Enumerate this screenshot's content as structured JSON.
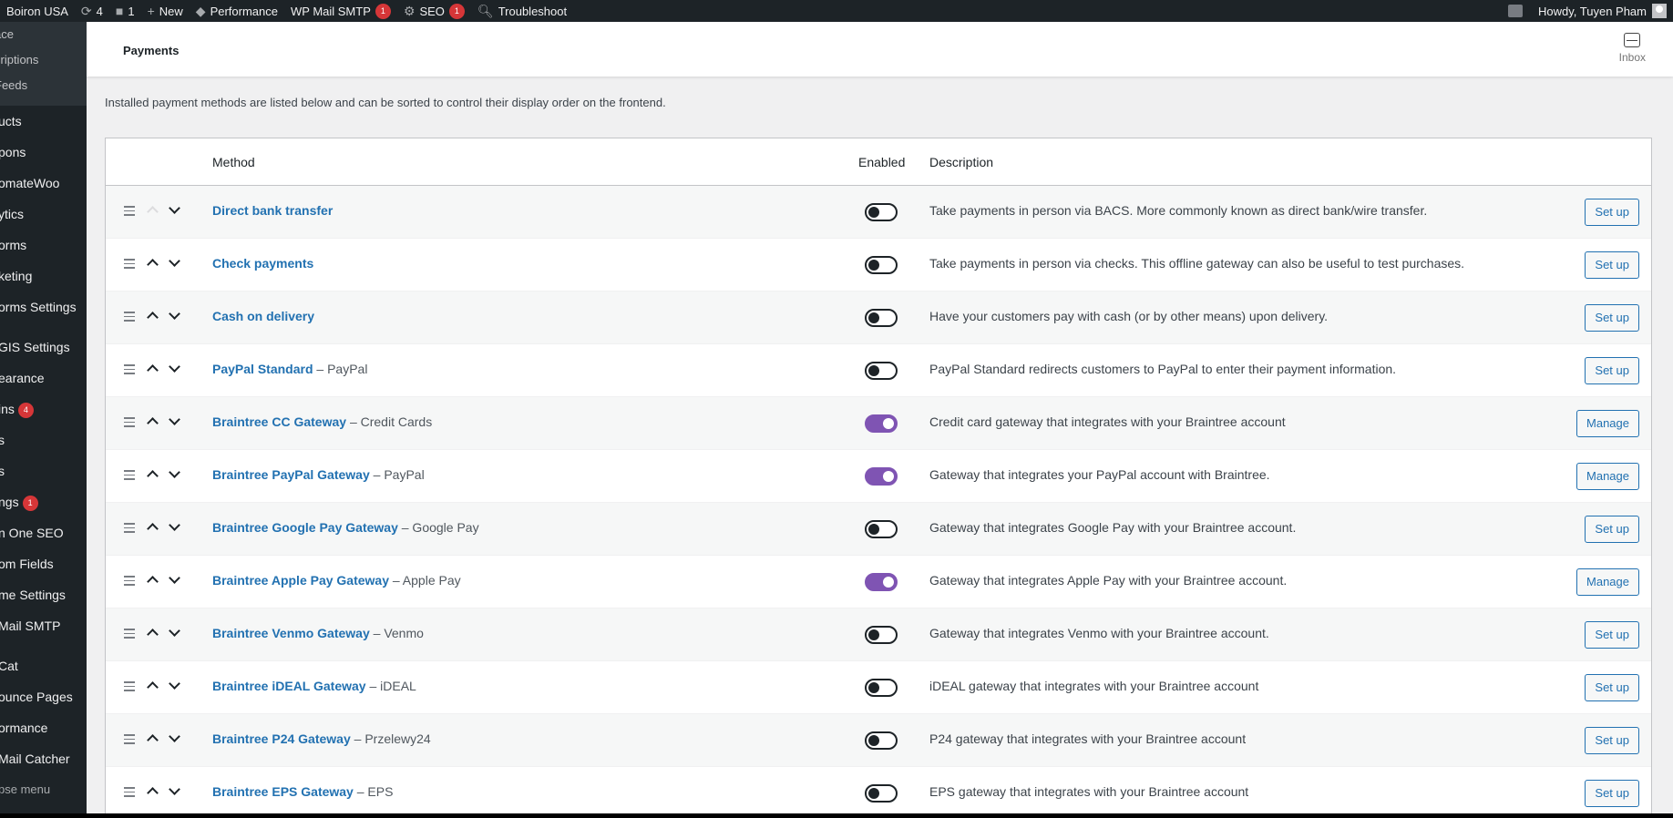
{
  "adminbar": {
    "site_name": "Boiron USA",
    "updates_count": "4",
    "comments_count": "1",
    "new_label": "New",
    "performance_label": "Performance",
    "mail_smtp_label": "WP Mail SMTP",
    "mail_smtp_badge": "1",
    "seo_label": "SEO",
    "seo_badge": "1",
    "troubleshoot_label": "Troubleshoot",
    "howdy": "Howdy, Tuyen Pham"
  },
  "sidebar": {
    "submenu": [
      "ace",
      "criptions",
      "Feeds"
    ],
    "menu": [
      {
        "label": "ucts"
      },
      {
        "label": "pons"
      },
      {
        "label": "omateWoo"
      },
      {
        "label": "ytics"
      },
      {
        "label": "orms"
      },
      {
        "label": "keting"
      },
      {
        "label": "orms Settings"
      },
      {
        "label": "GIS Settings"
      },
      {
        "label": "earance"
      },
      {
        "label": "ins",
        "badge": "4"
      },
      {
        "label": "s"
      },
      {
        "label": "s"
      },
      {
        "label": "ngs",
        "badge": "1"
      },
      {
        "label": "n One SEO"
      },
      {
        "label": "om Fields"
      },
      {
        "label": "me Settings"
      },
      {
        "label": "Mail SMTP"
      },
      {
        "label": "Cat"
      },
      {
        "label": "ounce Pages"
      },
      {
        "label": "ormance"
      },
      {
        "label": "Mail Catcher"
      },
      {
        "label": "pse menu"
      }
    ]
  },
  "header": {
    "title": "Payments",
    "inbox_label": "Inbox"
  },
  "intro": "Installed payment methods are listed below and can be sorted to control their display order on the frontend.",
  "table": {
    "col_method": "Method",
    "col_enabled": "Enabled",
    "col_description": "Description",
    "rows": [
      {
        "name": "Direct bank transfer",
        "sub": "",
        "enabled": false,
        "description": "Take payments in person via BACS. More commonly known as direct bank/wire transfer.",
        "action": "Set up",
        "up_disabled": true
      },
      {
        "name": "Check payments",
        "sub": "",
        "enabled": false,
        "description": "Take payments in person via checks. This offline gateway can also be useful to test purchases.",
        "action": "Set up"
      },
      {
        "name": "Cash on delivery",
        "sub": "",
        "enabled": false,
        "description": "Have your customers pay with cash (or by other means) upon delivery.",
        "action": "Set up"
      },
      {
        "name": "PayPal Standard",
        "sub": " – PayPal",
        "enabled": false,
        "description": "PayPal Standard redirects customers to PayPal to enter their payment information.",
        "action": "Set up"
      },
      {
        "name": "Braintree CC Gateway",
        "sub": " – Credit Cards",
        "enabled": true,
        "description": "Credit card gateway that integrates with your Braintree account",
        "action": "Manage"
      },
      {
        "name": "Braintree PayPal Gateway",
        "sub": " – PayPal",
        "enabled": true,
        "description": "Gateway that integrates your PayPal account with Braintree.",
        "action": "Manage"
      },
      {
        "name": "Braintree Google Pay Gateway",
        "sub": " – Google Pay",
        "enabled": false,
        "description": "Gateway that integrates Google Pay with your Braintree account.",
        "action": "Set up"
      },
      {
        "name": "Braintree Apple Pay Gateway",
        "sub": " – Apple Pay",
        "enabled": true,
        "description": "Gateway that integrates Apple Pay with your Braintree account.",
        "action": "Manage"
      },
      {
        "name": "Braintree Venmo Gateway",
        "sub": " – Venmo",
        "enabled": false,
        "description": "Gateway that integrates Venmo with your Braintree account.",
        "action": "Set up"
      },
      {
        "name": "Braintree iDEAL Gateway",
        "sub": " – iDEAL",
        "enabled": false,
        "description": "iDEAL gateway that integrates with your Braintree account",
        "action": "Set up"
      },
      {
        "name": "Braintree P24 Gateway",
        "sub": " – Przelewy24",
        "enabled": false,
        "description": "P24 gateway that integrates with your Braintree account",
        "action": "Set up"
      },
      {
        "name": "Braintree EPS Gateway",
        "sub": " – EPS",
        "enabled": false,
        "description": "EPS gateway that integrates with your Braintree account",
        "action": "Set up"
      }
    ]
  },
  "colors": {
    "link": "#2271b1",
    "toggle_on": "#7f54b3",
    "adminbar_bg": "#1d2327",
    "badge": "#d63638"
  }
}
